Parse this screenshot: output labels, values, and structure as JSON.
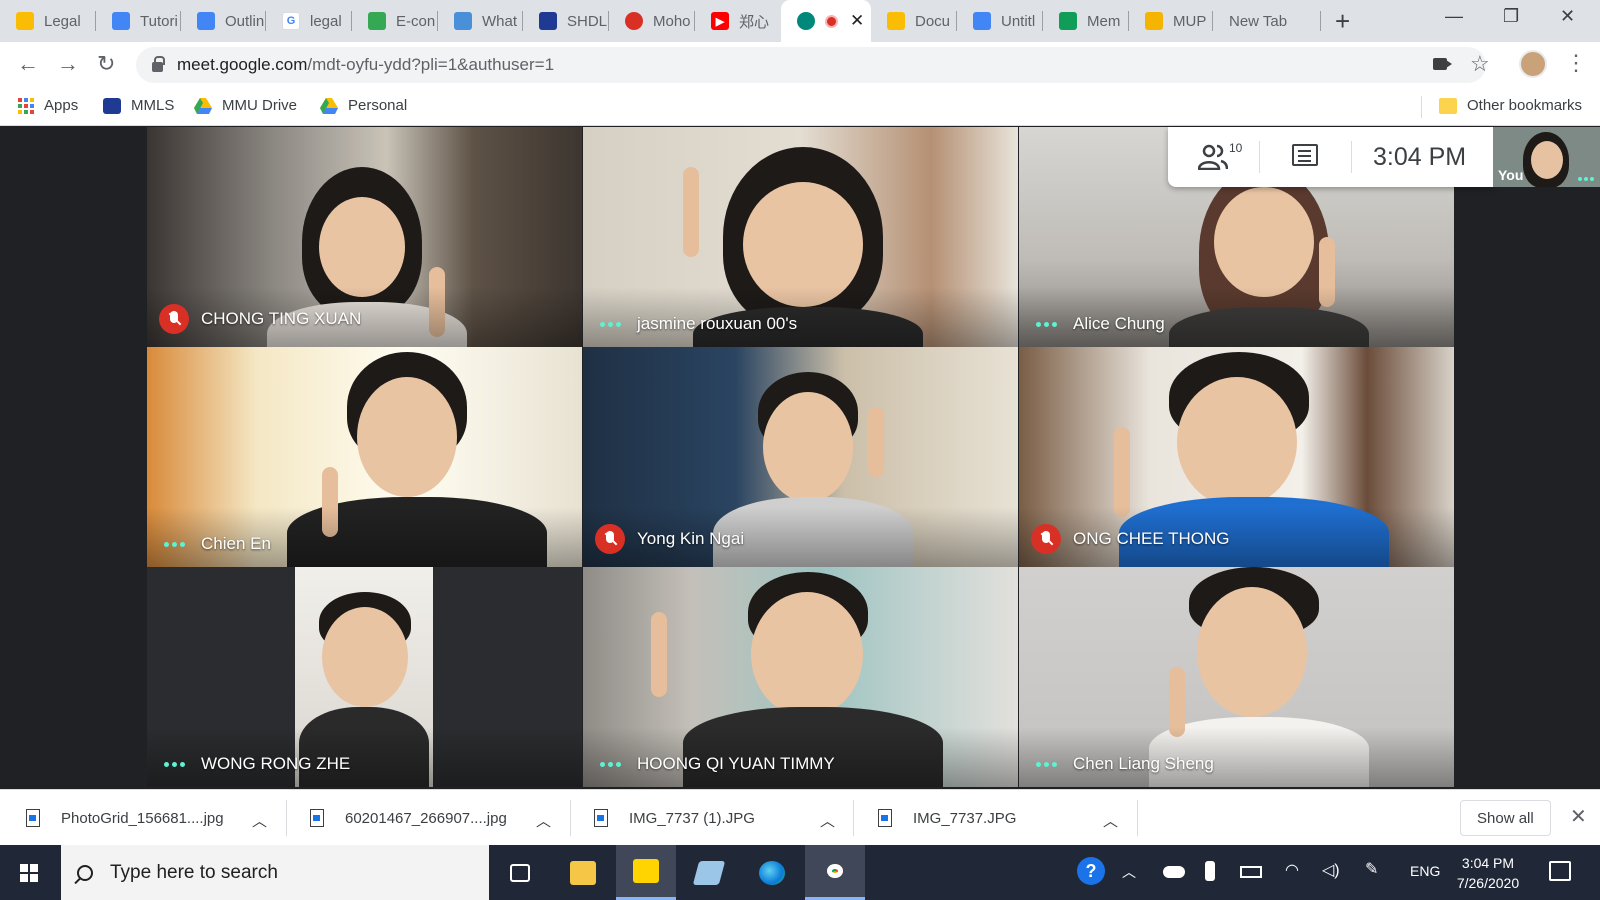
{
  "browser": {
    "tabs": [
      {
        "label": "Legal",
        "color": "#fbbc04"
      },
      {
        "label": "Tutori",
        "color": "#4285f4"
      },
      {
        "label": "Outlin",
        "color": "#4285f4"
      },
      {
        "label": "legal",
        "color": "#ea4335"
      },
      {
        "label": "E-con",
        "color": "#34a853"
      },
      {
        "label": "What",
        "color": "#4a90d9"
      },
      {
        "label": "SHDL",
        "color": "#1f3a93"
      },
      {
        "label": "Moho",
        "color": "#d93025"
      },
      {
        "label": "郑心",
        "color": "#ff0000"
      },
      {
        "label": "",
        "color": "#00897b"
      },
      {
        "label": "Docu",
        "color": "#fbbc04"
      },
      {
        "label": "Untitl",
        "color": "#4285f4"
      },
      {
        "label": "Mem",
        "color": "#0f9d58"
      },
      {
        "label": "MUP",
        "color": "#f4b400"
      },
      {
        "label": "New Tab",
        "color": ""
      }
    ],
    "url_host": "meet.google.com",
    "url_path": "/mdt-oyfu-ydd?pli=1&authuser=1",
    "bookmarks": [
      "Apps",
      "MMLS",
      "MMU Drive",
      "Personal"
    ],
    "other_bookmarks": "Other bookmarks"
  },
  "meet": {
    "participant_count": "10",
    "time": "3:04  PM",
    "self_label": "You",
    "participants": [
      {
        "name": "CHONG TING XUAN",
        "muted": true
      },
      {
        "name": "jasmine rouxuan 00's",
        "muted": false
      },
      {
        "name": "Alice Chung",
        "muted": false
      },
      {
        "name": "Chien En",
        "muted": false
      },
      {
        "name": "Yong Kin Ngai",
        "muted": true
      },
      {
        "name": "ONG CHEE THONG",
        "muted": true
      },
      {
        "name": "WONG RONG ZHE",
        "muted": false
      },
      {
        "name": "HOONG QI YUAN TIMMY",
        "muted": false
      },
      {
        "name": "Chen Liang Sheng",
        "muted": false
      }
    ]
  },
  "downloads": {
    "items": [
      "PhotoGrid_156681....jpg",
      "60201467_266907....jpg",
      "IMG_7737 (1).JPG",
      "IMG_7737.JPG"
    ],
    "show_all": "Show all"
  },
  "taskbar": {
    "search_placeholder": "Type here to search",
    "language": "ENG",
    "time": "3:04 PM",
    "date": "7/26/2020"
  }
}
